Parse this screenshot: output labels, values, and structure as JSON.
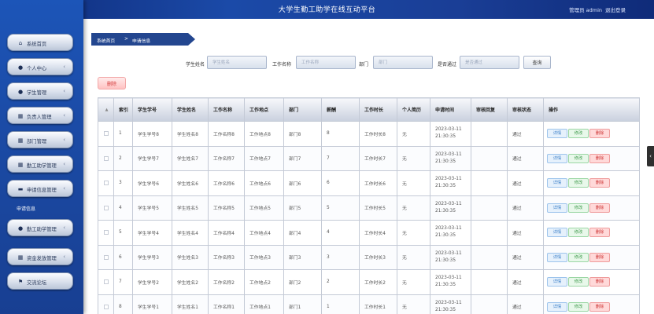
{
  "header": {
    "title": "大学生勤工助学在线互动平台",
    "user": "管理员 admin",
    "logout": "退出登录"
  },
  "sidebar": {
    "items": [
      {
        "label": "系统首页",
        "icon": "home-icon",
        "glyph": "⌂",
        "chevron": false
      },
      {
        "label": "个人中心",
        "icon": "user-icon",
        "glyph": "●",
        "chevron": true
      },
      {
        "label": "学生管理",
        "icon": "user-icon",
        "glyph": "●",
        "chevron": true
      },
      {
        "label": "负责人管理",
        "icon": "table-icon",
        "glyph": "▦",
        "chevron": true
      },
      {
        "label": "部门管理",
        "icon": "table-icon",
        "glyph": "▦",
        "chevron": true
      },
      {
        "label": "勤工助学管理",
        "icon": "grid-icon",
        "glyph": "▦",
        "chevron": true
      },
      {
        "label": "申请信息管理",
        "icon": "monitor-icon",
        "glyph": "▬",
        "chevron": true
      },
      {
        "label": "勤工助学管理",
        "icon": "user-icon",
        "glyph": "●",
        "chevron": true
      },
      {
        "label": "资金发放管理",
        "icon": "grid-icon",
        "glyph": "▦",
        "chevron": true
      },
      {
        "label": "交流论坛",
        "icon": "flag-icon",
        "glyph": "⚑",
        "chevron": false
      }
    ],
    "active_sub": "申请信息"
  },
  "breadcrumb": {
    "home": "系统首页",
    "sep": ">",
    "current": "申请信息"
  },
  "search": {
    "student_name_label": "学生姓名",
    "student_name_placeholder": "学生姓名",
    "job_name_label": "工作名称",
    "job_name_placeholder": "工作名称",
    "dept_label": "部门",
    "dept_placeholder": "部门",
    "passed_label": "是否通过",
    "passed_placeholder": "是否通过",
    "search_button": "查询"
  },
  "bulk_delete": "删除",
  "table": {
    "headers": [
      "",
      "索引",
      "学生学号",
      "学生姓名",
      "工作名称",
      "工作地点",
      "部门",
      "薪酬",
      "工作时长",
      "个人简历",
      "申请时间",
      "审核回复",
      "审核状态",
      "操作"
    ],
    "actions": {
      "detail": "详情",
      "edit": "修改",
      "delete": "删除"
    },
    "rows": [
      [
        "1",
        "学生学号8",
        "学生姓名8",
        "工作名称8",
        "工作地点8",
        "部门8",
        "8",
        "工作时长8",
        "无",
        "2023-03-11 21:30:35",
        "",
        "通过"
      ],
      [
        "2",
        "学生学号7",
        "学生姓名7",
        "工作名称7",
        "工作地点7",
        "部门7",
        "7",
        "工作时长7",
        "无",
        "2023-03-11 21:30:35",
        "",
        "通过"
      ],
      [
        "3",
        "学生学号6",
        "学生姓名6",
        "工作名称6",
        "工作地点6",
        "部门6",
        "6",
        "工作时长6",
        "无",
        "2023-03-11 21:30:35",
        "",
        "通过"
      ],
      [
        "4",
        "学生学号5",
        "学生姓名5",
        "工作名称5",
        "工作地点5",
        "部门5",
        "5",
        "工作时长5",
        "无",
        "2023-03-11 21:30:35",
        "",
        "通过"
      ],
      [
        "5",
        "学生学号4",
        "学生姓名4",
        "工作名称4",
        "工作地点4",
        "部门4",
        "4",
        "工作时长4",
        "无",
        "2023-03-11 21:30:35",
        "",
        "通过"
      ],
      [
        "6",
        "学生学号3",
        "学生姓名3",
        "工作名称3",
        "工作地点3",
        "部门3",
        "3",
        "工作时长3",
        "无",
        "2023-03-11 21:30:35",
        "",
        "通过"
      ],
      [
        "7",
        "学生学号2",
        "学生姓名2",
        "工作名称2",
        "工作地点2",
        "部门2",
        "2",
        "工作时长2",
        "无",
        "2023-03-11 21:30:35",
        "",
        "通过"
      ],
      [
        "8",
        "学生学号1",
        "学生姓名1",
        "工作名称1",
        "工作地点1",
        "部门1",
        "1",
        "工作时长1",
        "无",
        "2023-03-11 21:30:35",
        "",
        "通过"
      ]
    ]
  },
  "colors": {
    "accent": "#23468f",
    "sidebar": "#1b4ba6",
    "delete": "#cc3333"
  }
}
